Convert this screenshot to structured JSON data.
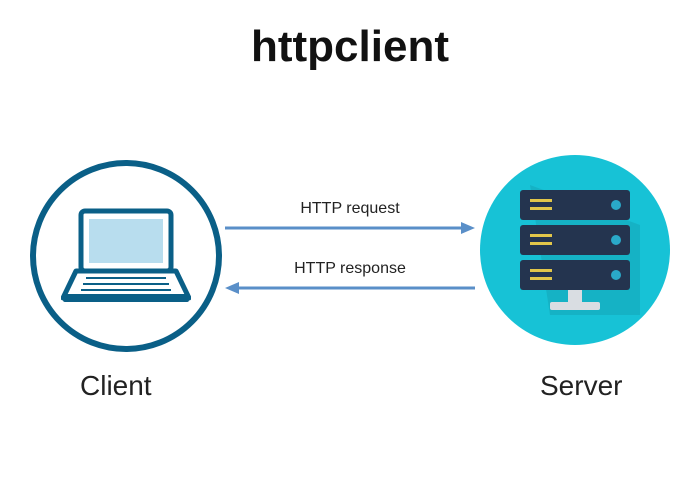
{
  "title": "httpclient",
  "client_label": "Client",
  "server_label": "Server",
  "arrows": {
    "request_label": "HTTP request",
    "response_label": "HTTP response"
  },
  "colors": {
    "client_border": "#0a5f87",
    "server_bg": "#17c2d6",
    "arrow": "#5a8fc8",
    "server_rack": "#24344f",
    "accent_yellow": "#e2c64a",
    "accent_blue": "#2aa9c9"
  }
}
